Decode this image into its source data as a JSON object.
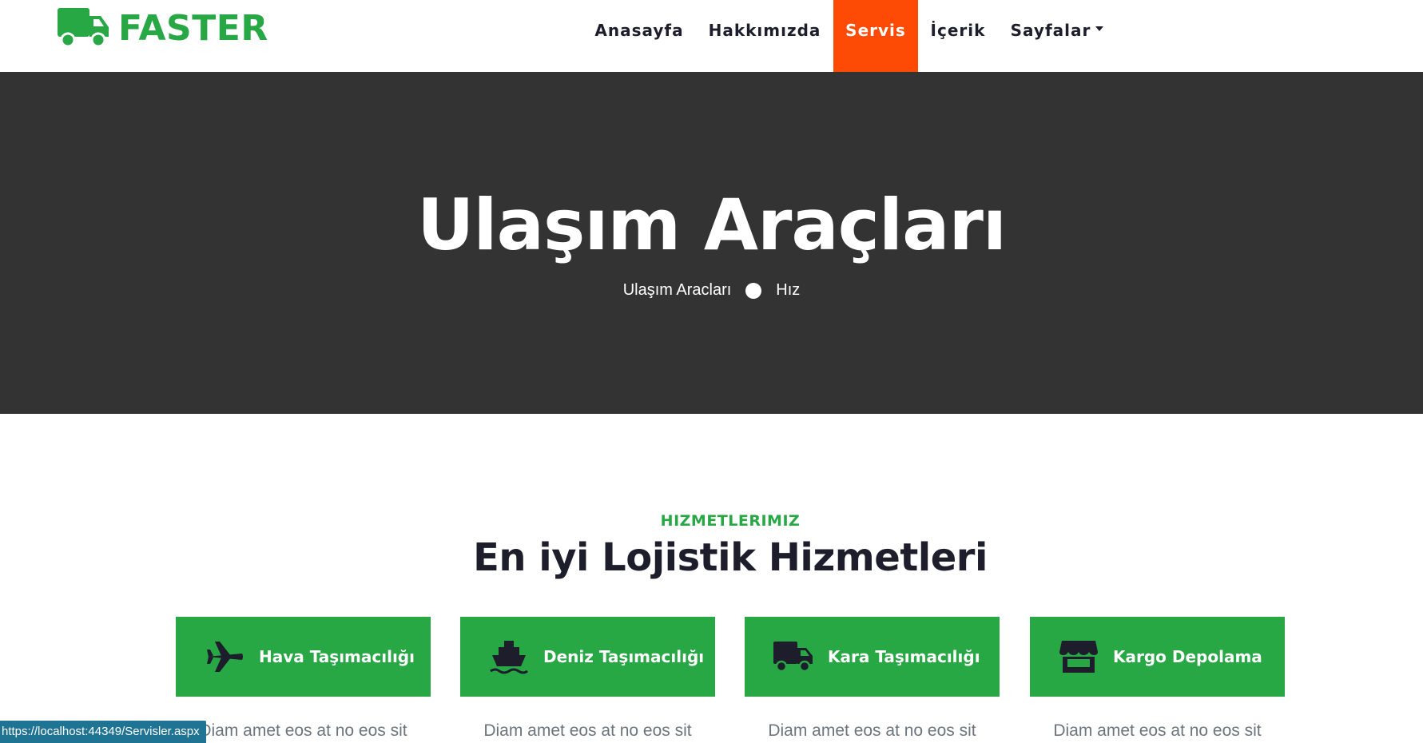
{
  "brand": {
    "name": "FASTER",
    "icon": "truck-icon",
    "color": "#28a745"
  },
  "nav": {
    "items": [
      {
        "label": "Anasayfa"
      },
      {
        "label": "Hakkımızda"
      },
      {
        "label": "Servis",
        "active": true
      },
      {
        "label": "İçerik"
      },
      {
        "label": "Sayfalar",
        "dropdown": true
      }
    ],
    "active_color": "#fd4b05"
  },
  "hero": {
    "title": "Ulaşım Araçları",
    "breadcrumb": [
      "Ulaşım Aracları",
      "Hız"
    ]
  },
  "services_section": {
    "kicker": "HIZMETLERIMIZ",
    "title": "En iyi Lojistik Hizmetleri",
    "cards": [
      {
        "label": "Hava Taşımacılığı",
        "icon": "plane-icon",
        "desc": "Diam amet eos at no eos sit"
      },
      {
        "label": "Deniz Taşımacılığı",
        "icon": "ship-icon",
        "desc": "Diam amet eos at no eos sit"
      },
      {
        "label": "Kara Taşımacılığı",
        "icon": "truck-icon",
        "desc": "Diam amet eos at no eos sit"
      },
      {
        "label": "Kargo Depolama",
        "icon": "warehouse-icon",
        "desc": "Diam amet eos at no eos sit"
      }
    ]
  },
  "status_bar": {
    "url": "https://localhost:44349/Servisler.aspx"
  },
  "colors": {
    "accent": "#28a745",
    "hero_bg": "#333333",
    "dark_text": "#1d1d2c"
  }
}
